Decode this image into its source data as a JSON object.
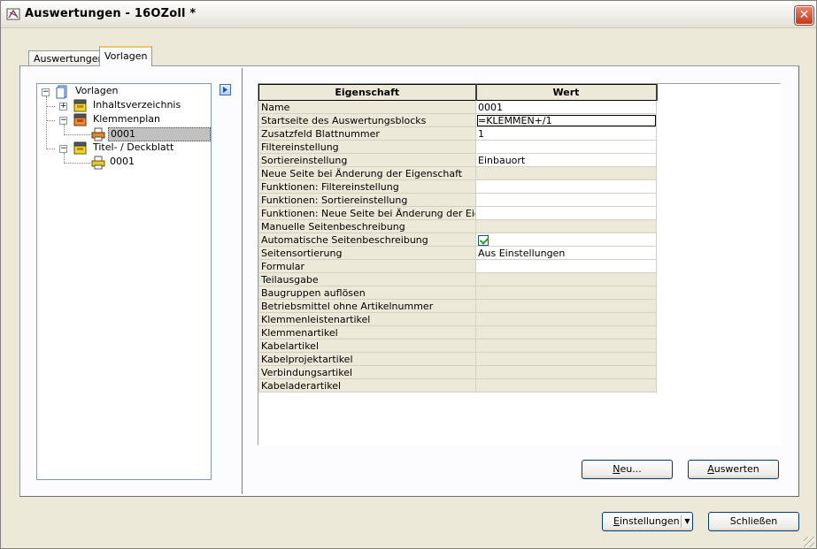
{
  "window": {
    "title": "Auswertungen - 16OZoll *",
    "close_label": "✕"
  },
  "tabs": [
    {
      "label": "Auswertungen",
      "active": false
    },
    {
      "label": "Vorlagen",
      "active": true
    }
  ],
  "tree": {
    "root": {
      "label": "Vorlagen",
      "expander": "−"
    },
    "nodes": [
      {
        "label": "Inhaltsverzeichnis",
        "expander": "+"
      },
      {
        "label": "Klemmenplan",
        "expander": "−"
      },
      {
        "label": "0001",
        "selected": true
      },
      {
        "label": "Titel- / Deckblatt",
        "expander": "−"
      },
      {
        "label": "0001",
        "selected": false
      }
    ]
  },
  "grid": {
    "headers": {
      "property": "Eigenschaft",
      "value": "Wert"
    },
    "rows": [
      {
        "property": "Name",
        "value": "0001",
        "editable": true
      },
      {
        "property": "Startseite des Auswertungsblocks",
        "value": "=KLEMMEN+/1",
        "editable": true,
        "focused": true
      },
      {
        "property": "Zusatzfeld Blattnummer",
        "value": "1",
        "editable": true
      },
      {
        "property": "Filtereinstellung",
        "value": "",
        "editable": true
      },
      {
        "property": "Sortiereinstellung",
        "value": "Einbauort",
        "editable": true
      },
      {
        "property": "Neue Seite bei Änderung der Eigenschaft",
        "value": "",
        "editable": false
      },
      {
        "property": "Funktionen: Filtereinstellung",
        "value": "",
        "editable": true
      },
      {
        "property": "Funktionen: Sortiereinstellung",
        "value": "",
        "editable": true
      },
      {
        "property": "Funktionen: Neue Seite bei Änderung der Eigen...",
        "value": "",
        "editable": true
      },
      {
        "property": "Manuelle Seitenbeschreibung",
        "value": "",
        "editable": false
      },
      {
        "property": "Automatische Seitenbeschreibung",
        "value": "",
        "editable": true,
        "checkbox": true
      },
      {
        "property": "Seitensortierung",
        "value": "Aus Einstellungen",
        "editable": true
      },
      {
        "property": "Formular",
        "value": "",
        "editable": true
      },
      {
        "property": "Teilausgabe",
        "value": "",
        "editable": false
      },
      {
        "property": "Baugruppen auflösen",
        "value": "",
        "editable": false
      },
      {
        "property": "Betriebsmittel ohne Artikelnummer",
        "value": "",
        "editable": false
      },
      {
        "property": "Klemmenleistenartikel",
        "value": "",
        "editable": false
      },
      {
        "property": "Klemmenartikel",
        "value": "",
        "editable": false
      },
      {
        "property": "Kabelartikel",
        "value": "",
        "editable": false
      },
      {
        "property": "Kabelprojektartikel",
        "value": "",
        "editable": false
      },
      {
        "property": "Verbindungsartikel",
        "value": "",
        "editable": false
      },
      {
        "property": "Kabeladerartikel",
        "value": "",
        "editable": false
      }
    ]
  },
  "buttons": {
    "neu": {
      "mnemonic": "N",
      "rest": "eu..."
    },
    "auswerten": {
      "mnemonic": "A",
      "rest": "uswerten"
    },
    "einstellungen": {
      "mnemonic": "E",
      "rest": "instellungen",
      "arrow": "▼"
    },
    "schliessen": "Schließen"
  },
  "colors": {
    "dialog_bg": "#ece9d8",
    "selection_gray": "#c0c0c0",
    "close_red": "#c4391a",
    "tab_highlight": "#f5c45a",
    "check_green": "#21a121"
  }
}
